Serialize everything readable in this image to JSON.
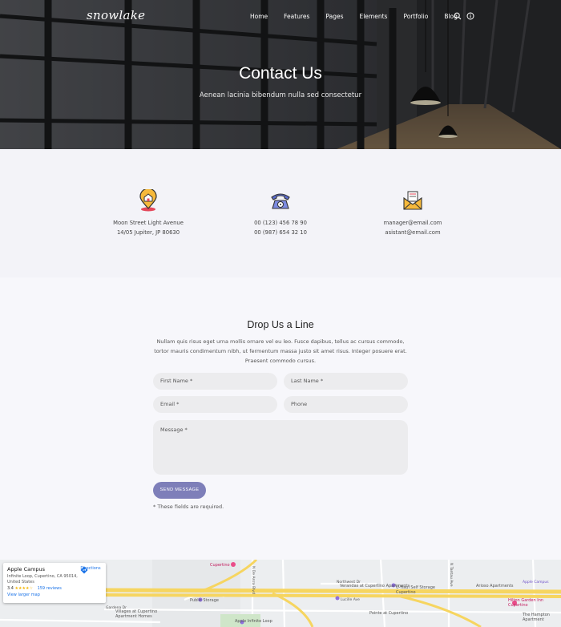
{
  "brand": {
    "logo": "snowlake"
  },
  "nav": {
    "items": [
      "Home",
      "Features",
      "Pages",
      "Elements",
      "Portfolio",
      "Blog"
    ]
  },
  "header_icons": [
    "search-icon",
    "info-icon"
  ],
  "hero": {
    "title": "Contact Us",
    "subtitle": "Aenean lacinia bibendum nulla sed consectetur"
  },
  "contact_info": {
    "address": {
      "icon": "house-pin-icon",
      "line1": "Moon Street Light Avenue",
      "line2": "14/05 Jupiter, JP 80630"
    },
    "phone": {
      "icon": "telephone-icon",
      "line1": "00 (123) 456 78 90",
      "line2": "00 (987) 654 32 10"
    },
    "email": {
      "icon": "envelope-icon",
      "line1": "manager@email.com",
      "line2": "asistant@email.com"
    }
  },
  "form": {
    "title": "Drop Us a Line",
    "description": "Nullam quis risus eget urna mollis ornare vel eu leo. Fusce dapibus, tellus ac cursus commodo, tortor mauris condimentum nibh, ut fermentum massa justo sit amet risus. Integer posuere erat. Praesent commodo cursus.",
    "first_name": "First Name *",
    "last_name": "Last Name *",
    "email": "Email *",
    "phone": "Phone",
    "message": "Message *",
    "submit": "SEND MESSAGE",
    "required_note": "* These fields are required."
  },
  "map": {
    "place": "Apple Campus",
    "address": "Infinite Loop, Cupertino, CA 95014, United States",
    "rating": "3.4",
    "stars": "★★★★☆",
    "reviews": "159 reviews",
    "directions": "Directions",
    "larger_map": "View larger map",
    "labels": [
      "Cupertino",
      "Public Storage",
      "Villages at Cupertino Apartment Homes",
      "Apple Infinite Loop",
      "Verandas at Cupertino Apartments",
      "Northwest Dr",
      "Pointe at Cupertino",
      "Lucille Ave",
      "Arioso Apartments",
      "Hilton Garden Inn Cupertino",
      "The Hampton Apartment",
      "U-Haul Self Storage Cupertino",
      "Gardena Dr",
      "N De Anza Blvd",
      "N Tantau Ave",
      "Apple Campus"
    ]
  },
  "colors": {
    "accent": "#7e7fb9",
    "background": "#f6f6fa",
    "field": "#ececee"
  }
}
